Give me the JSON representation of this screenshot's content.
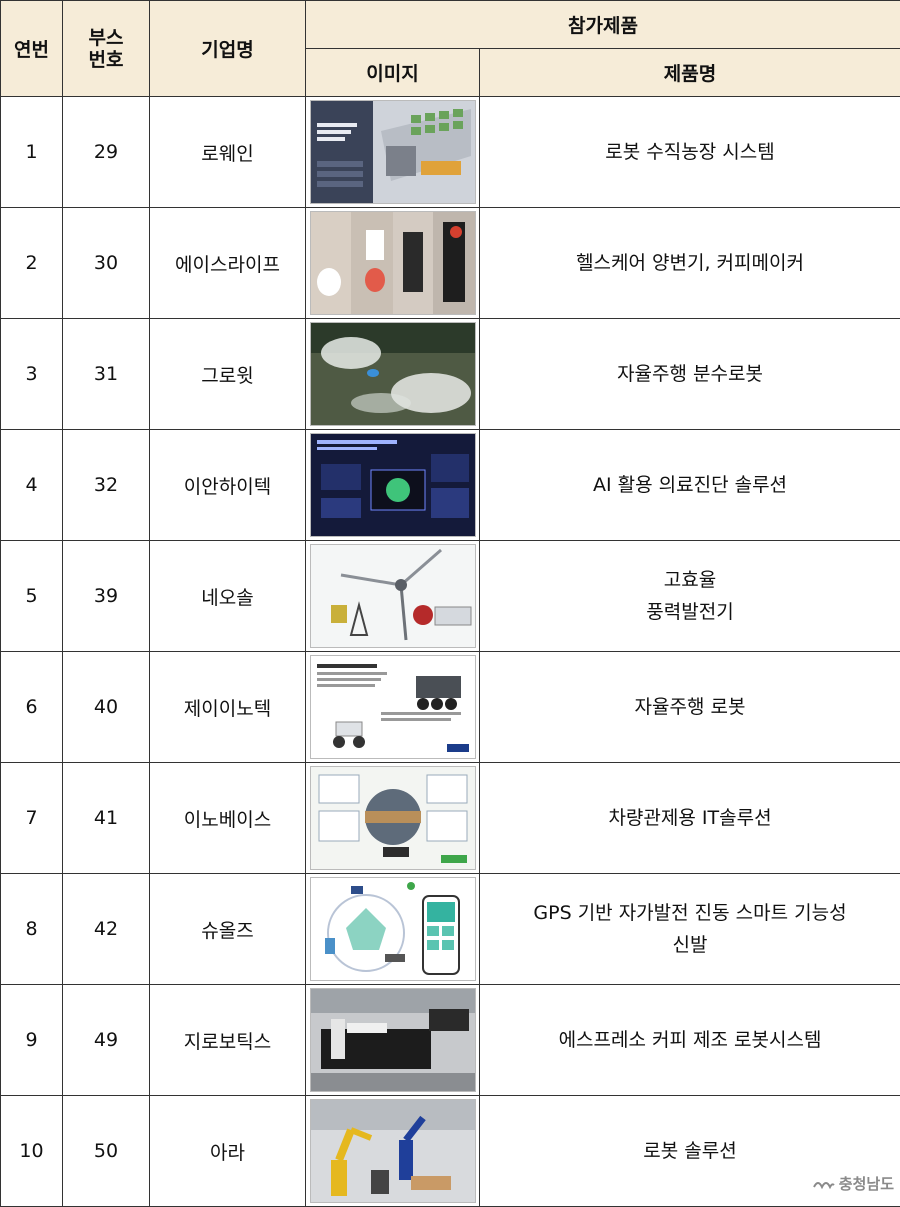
{
  "header": {
    "no": "연번",
    "booth": "부스\n번호",
    "booth_line1": "부스",
    "booth_line2": "번호",
    "company": "기업명",
    "products": "참가제품",
    "image": "이미지",
    "product_name": "제품명"
  },
  "rows": [
    {
      "no": "1",
      "booth": "29",
      "company": "로웨인",
      "product": "로봇 수직농장 시스템",
      "image": "robotic-vertical-farming-image"
    },
    {
      "no": "2",
      "booth": "30",
      "company": "에이스라이프",
      "product": "헬스케어 양변기, 커피메이커",
      "image": "toilet-coffee-maker-image"
    },
    {
      "no": "3",
      "booth": "31",
      "company": "그로윗",
      "product": "자율주행 분수로봇",
      "image": "fountain-robot-image"
    },
    {
      "no": "4",
      "booth": "32",
      "company": "이안하이텍",
      "product": "AI 활용 의료진단 솔루션",
      "image": "medical-imaging-platform-image"
    },
    {
      "no": "5",
      "booth": "39",
      "company": "네오솔",
      "product_line1": "고효율",
      "product_line2": "풍력발전기",
      "image": "wind-turbine-image"
    },
    {
      "no": "6",
      "booth": "40",
      "company": "제이이노텍",
      "product": "자율주행 로봇",
      "image": "autonomous-robot-image"
    },
    {
      "no": "7",
      "booth": "41",
      "company": "이노베이스",
      "product": "차량관제용 IT솔루션",
      "image": "vehicle-control-solution-image"
    },
    {
      "no": "8",
      "booth": "42",
      "company": "슈올즈",
      "product_line1": "GPS 기반 자가발전 진동 스마트 기능성",
      "product_line2": "신발",
      "image": "smart-shoes-app-image"
    },
    {
      "no": "9",
      "booth": "49",
      "company": "지로보틱스",
      "product": "에스프레소 커피 제조 로봇시스템",
      "image": "espresso-robot-image"
    },
    {
      "no": "10",
      "booth": "50",
      "company": "아라",
      "product": "로봇 솔루션",
      "image": "industrial-robot-arm-image"
    }
  ],
  "watermark": "충청남도",
  "colors": {
    "header_bg": "#f6ecd8",
    "border": "#333333"
  }
}
